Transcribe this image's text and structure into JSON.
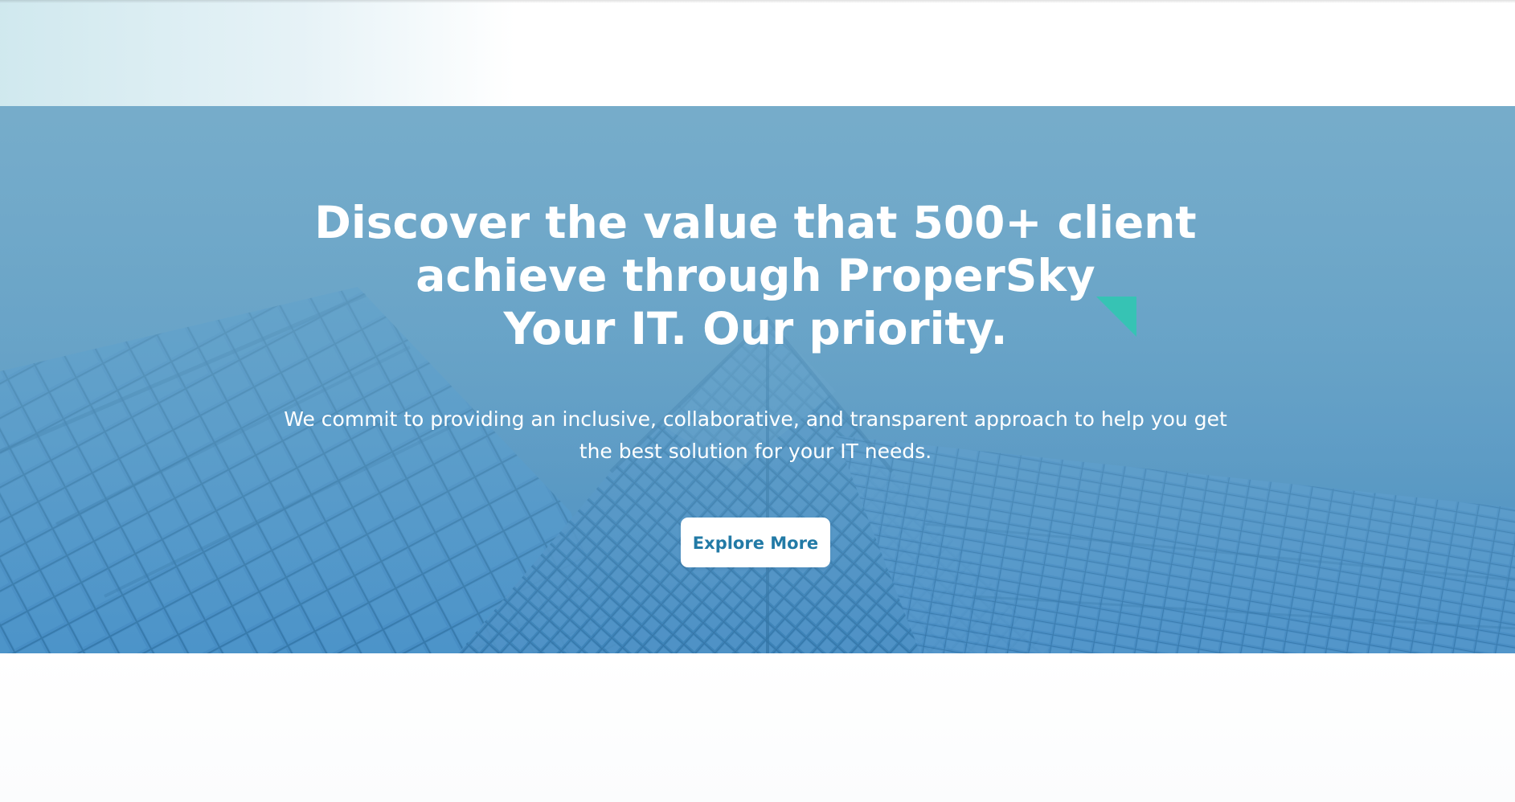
{
  "hero": {
    "headline_lines": [
      "Discover the value that 500+ client",
      "achieve through ProperSky",
      "Your IT. Our priority."
    ],
    "body_lines": [
      "We commit to providing an inclusive, collaborative, and transparent  approach to help you get",
      "the best solution for your IT needs."
    ],
    "cta_label": "Explore More"
  },
  "colors": {
    "hero_overlay": "#6fa8c9",
    "text": "#ffffff",
    "button_background": "#ffffff",
    "button_text": "#227aa6",
    "accent_triangle": "#36c3b4"
  }
}
